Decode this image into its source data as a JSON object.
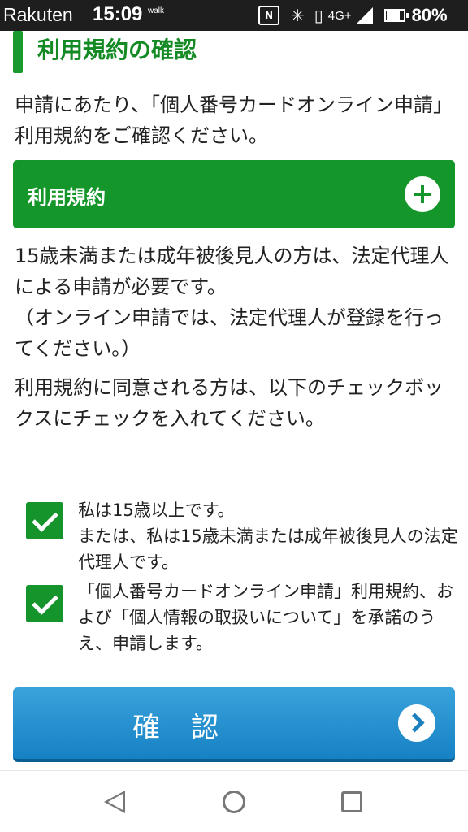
{
  "status_bar": {
    "carrier": "Rakuten",
    "time": "15:09",
    "walk_label": "walk",
    "nfc_label": "N",
    "network": "4G+",
    "battery_percent": "80%"
  },
  "page": {
    "heading": "利用規約の確認",
    "intro_text": "申請にあたり、「個人番号カードオンライン申請」利用規約をご確認ください。",
    "terms_accordion": {
      "label": "利用規約",
      "expanded": false
    },
    "note_lines": [
      "15歳未満または成年被後見人の方は、法定代理人による申請が必要です。",
      "（オンライン申請では、法定代理人が登録を行ってください。）"
    ],
    "agree_instruction": "利用規約に同意される方は、以下のチェックボックスにチェックを入れてください。",
    "checkboxes": [
      {
        "lines": [
          "私は15歳以上です。",
          "または、私は15歳未満または成年被後見人の法定代理人です。"
        ],
        "checked": true
      },
      {
        "lines": [
          "「個人番号カードオンライン申請」利用規約、および「個人情報の取扱いについて」を承諾のうえ、申請します。"
        ],
        "checked": true
      }
    ],
    "confirm_button": "確認"
  },
  "colors": {
    "brand_green": "#15962b",
    "button_blue": "#1a85c8",
    "status_bar": "#1e1e1e"
  },
  "icons": {
    "expand": "plus-circle-icon",
    "confirm": "chevron-right-circle-icon",
    "nav": [
      "back-triangle-icon",
      "home-circle-icon",
      "recents-square-icon"
    ]
  }
}
